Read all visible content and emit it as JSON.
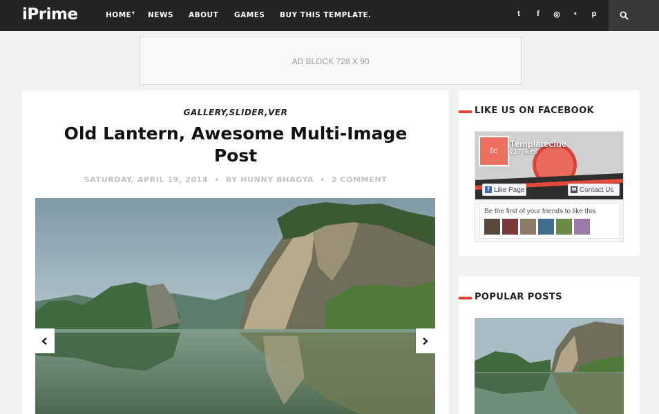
{
  "header": {
    "logo": "iPrime",
    "nav": [
      "HOME",
      "NEWS",
      "ABOUT",
      "GAMES",
      "BUY THIS TEMPLATE."
    ],
    "social_icons": [
      "twitter-icon",
      "facebook-icon",
      "dribbble-icon",
      "flickr-icon",
      "pinterest-icon"
    ],
    "social_glyphs": [
      "t",
      "f",
      "◎",
      "▪",
      "p"
    ]
  },
  "ad": {
    "label": "AD BLOCK 728 X 90"
  },
  "post": {
    "categories": "GALLERY,SLIDER,VER",
    "title": "Old Lantern, Awesome Multi-Image Post",
    "date": "SATURDAY, APRIL 19, 2014",
    "author": "BY HUNNY BHAGYA",
    "comments": "2 COMMENT"
  },
  "sidebar": {
    "facebook": {
      "title": "LIKE US ON FACEBOOK",
      "page_name": "Templateclue",
      "likes": "717 likes",
      "thumb_text": "tc",
      "like_button": "Like Page",
      "contact_button": "Contact Us",
      "friends_text": "Be the first of your friends to like this"
    },
    "popular": {
      "title": "POPULAR POSTS"
    }
  },
  "colors": {
    "accent": "#e0402f",
    "topbar": "#242424",
    "background": "#f1f1f1"
  }
}
